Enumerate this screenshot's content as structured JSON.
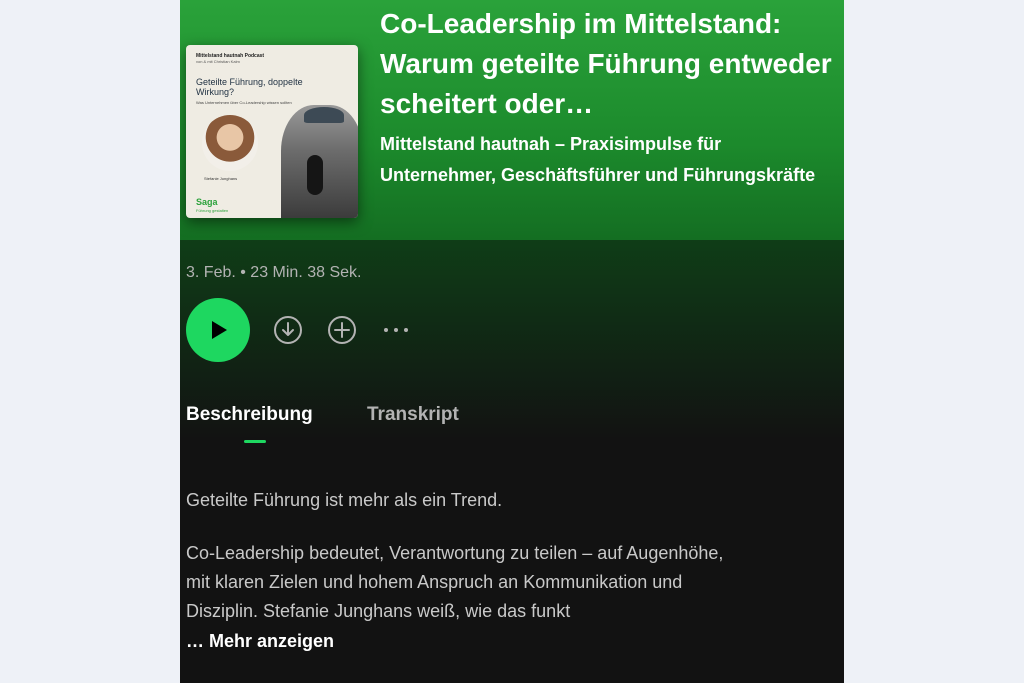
{
  "episode": {
    "title": "Co-Leadership im Mittelstand: Warum geteilte Führung entweder scheitert oder…",
    "show": "Mittelstand hautnah – Praxisimpulse für Unternehmer, Geschäftsführer und Führungskräfte",
    "meta": "3. Feb. • 23 Min. 38 Sek."
  },
  "cover": {
    "brand": "Mittelstand hautnah Podcast",
    "brand_sub": "von & mit Christian Kalm",
    "title": "Geteilte Führung, doppelte Wirkung?",
    "subtitle": "Was Unternehmen über Co-Leadership wissen sollten",
    "guest": "Stefanie Junghans",
    "logo": "Saga",
    "logo_sub": "Führung gestalten"
  },
  "controls": {
    "play": "play-icon",
    "download": "download-icon",
    "add": "add-icon",
    "more": "more-icon"
  },
  "tabs": [
    {
      "label": "Beschreibung",
      "active": true
    },
    {
      "label": "Transkript",
      "active": false
    }
  ],
  "description": {
    "p1": "Geteilte Führung ist mehr als ein Trend.",
    "p2": "Co-Leadership bedeutet, Verantwortung zu teilen – auf Augenhöhe,\nmit klaren Zielen und hohem Anspruch an Kommunikation und\nDisziplin. Stefanie Junghans weiß, wie das funkt",
    "more": "… Mehr anzeigen"
  },
  "colors": {
    "accent": "#1ed760",
    "hero": "#2aa23a",
    "background": "#121212"
  }
}
